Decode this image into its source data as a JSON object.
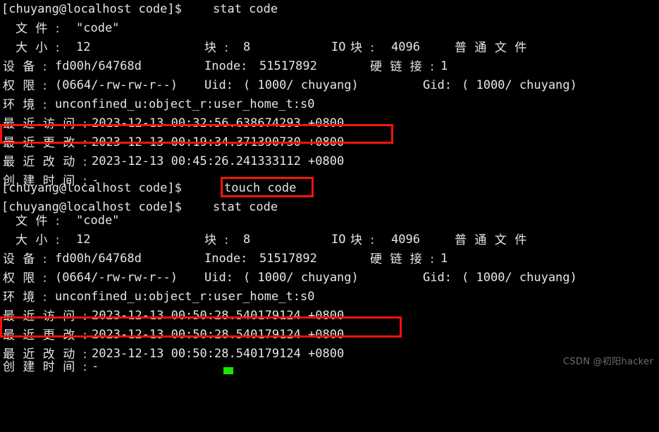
{
  "terminal": {
    "prompt": "[chuyang@localhost code]$",
    "colors": {
      "background": "#000000",
      "foreground": "#e6e6e6",
      "highlight_box": "#fa1405",
      "cursor": "#17e600",
      "watermark": "#6e6e6e"
    },
    "commands": {
      "stat_first": "stat code",
      "touch": "touch code",
      "stat_second": "stat code"
    },
    "labels": {
      "file": "文 件 :",
      "size": "大 小 :",
      "blocks": "块 :",
      "io_block": "IO 块 :",
      "file_type": "普 通 文 件",
      "device": "设 备 :",
      "inode": "Inode:",
      "links": "硬 链 接 :",
      "permissions": "权 限 :",
      "uid": "Uid:",
      "gid": "Gid:",
      "context": "环 境 :",
      "access": "最 近 访 问 :",
      "modify": "最 近 更 改 :",
      "change": "最 近 改 动 :",
      "birth": "创 建 时 间 :"
    },
    "stat_block_1": {
      "file": "\"code\"",
      "size": "12",
      "blocks": "8",
      "io_block": "4096",
      "file_type": "普 通 文 件",
      "device": "fd00h/64768d",
      "inode": "51517892",
      "links": "1",
      "permissions": "(0664/-rw-rw-r--)",
      "uid": "( 1000/ chuyang)",
      "gid": "( 1000/ chuyang)",
      "context": "unconfined_u:object_r:user_home_t:s0",
      "access": "2023-12-13 00:32:56.638674293 +0800",
      "modify": "2023-12-13 00:19:34.371390730 +0800",
      "change": "2023-12-13 00:45:26.241333112 +0800",
      "birth": "-"
    },
    "stat_block_2": {
      "file": "\"code\"",
      "size": "12",
      "blocks": "8",
      "io_block": "4096",
      "file_type": "普 通 文 件",
      "device": "fd00h/64768d",
      "inode": "51517892",
      "links": "1",
      "permissions": "(0664/-rw-rw-r--)",
      "uid": "( 1000/ chuyang)",
      "gid": "( 1000/ chuyang)",
      "context": "unconfined_u:object_r:user_home_t:s0",
      "access": "2023-12-13 00:50:28.540179124 +0800",
      "modify": "2023-12-13 00:50:28.540179124 +0800",
      "change": "2023-12-13 00:50:28.540179124 +0800",
      "birth": "-"
    }
  },
  "watermark": "CSDN @初阳hacker"
}
